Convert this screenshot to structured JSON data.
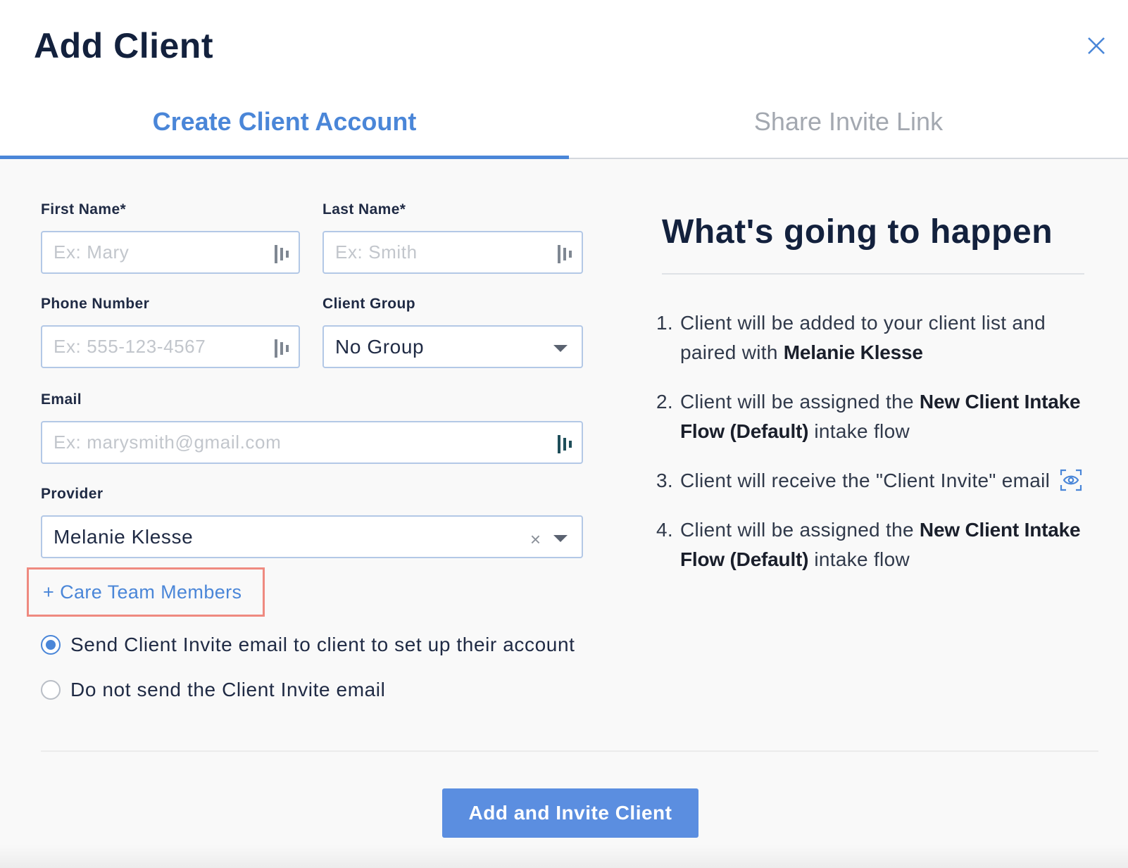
{
  "dialog": {
    "title": "Add Client"
  },
  "tabs": [
    {
      "label": "Create Client Account",
      "active": true
    },
    {
      "label": "Share Invite Link",
      "active": false
    }
  ],
  "form": {
    "first_name": {
      "label": "First Name*",
      "placeholder": "Ex: Mary",
      "value": ""
    },
    "last_name": {
      "label": "Last Name*",
      "placeholder": "Ex: Smith",
      "value": ""
    },
    "phone": {
      "label": "Phone Number",
      "placeholder": "Ex: 555-123-4567",
      "value": ""
    },
    "client_group": {
      "label": "Client Group",
      "value": "No Group"
    },
    "email": {
      "label": "Email",
      "placeholder": "Ex: marysmith@gmail.com",
      "value": ""
    },
    "provider": {
      "label": "Provider",
      "value": "Melanie Klesse",
      "clear": "×"
    },
    "care_team_link": "+ Care Team Members",
    "invite_options": [
      {
        "label": "Send Client Invite email to client to set up their account",
        "checked": true
      },
      {
        "label": "Do not send the Client Invite email",
        "checked": false
      }
    ]
  },
  "side": {
    "title": "What's going to happen",
    "steps": [
      {
        "num": "1.",
        "text_a": "Client will be added to your client list and paired with ",
        "bold": "Melanie Klesse",
        "text_b": ""
      },
      {
        "num": "2.",
        "text_a": "Client will be assigned the ",
        "bold": "New Client Intake Flow (Default)",
        "text_b": " intake flow"
      },
      {
        "num": "3.",
        "text_a": "Client will receive the \"Client Invite\" email",
        "bold": "",
        "text_b": ""
      },
      {
        "num": "4.",
        "text_a": "Client will be assigned the ",
        "bold": "New Client Intake Flow (Default)",
        "text_b": " intake flow"
      }
    ]
  },
  "footer": {
    "submit_label": "Add and Invite Client"
  },
  "colors": {
    "accent": "#4a86d8",
    "button": "#5b8ee0",
    "highlight_border": "#ef8a80",
    "heading": "#13213d"
  },
  "icons": {
    "close": "close-icon",
    "autofill": "password-manager-icon",
    "dropdown": "chevron-down-icon",
    "preview": "eye-preview-icon"
  }
}
